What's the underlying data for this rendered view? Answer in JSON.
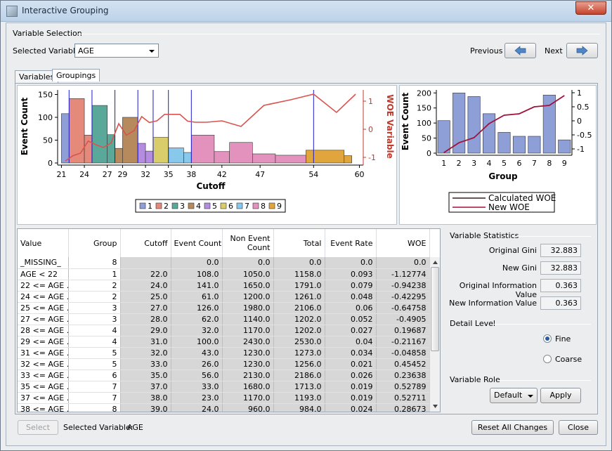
{
  "window": {
    "title": "Interactive Grouping",
    "close_glyph": "✕"
  },
  "variable_selection": {
    "section_title": "Variable Selection",
    "selected_label": "Selected Variable",
    "selected_value": "AGE",
    "previous_label": "Previous",
    "next_label": "Next"
  },
  "tabs": [
    {
      "label": "Variables"
    },
    {
      "label": "Groupings"
    }
  ],
  "chart_data": [
    {
      "type": "bar",
      "xlabel": "Cutoff",
      "ylabel": "Event Count",
      "y2label": "WOE Variable",
      "yticks": [
        0,
        50,
        100,
        150
      ],
      "y2ticks": [
        -1,
        0,
        1
      ],
      "xticks": [
        21,
        24,
        27,
        29,
        32,
        35,
        38,
        42,
        47,
        54,
        60
      ],
      "xlim": [
        20.5,
        60.5
      ],
      "ylim": [
        0,
        160
      ],
      "y2lim": [
        -1.2,
        1.4
      ],
      "groups": [
        {
          "name": "1",
          "color": "#8e9fd8"
        },
        {
          "name": "2",
          "color": "#e5897a"
        },
        {
          "name": "3",
          "color": "#5aa89a"
        },
        {
          "name": "4",
          "color": "#b68a5c"
        },
        {
          "name": "5",
          "color": "#b58de0"
        },
        {
          "name": "6",
          "color": "#d9cc6a"
        },
        {
          "name": "7",
          "color": "#88c8ea"
        },
        {
          "name": "8",
          "color": "#e391bd"
        },
        {
          "name": "9",
          "color": "#e0a53d"
        }
      ],
      "bars": [
        {
          "x0": 21,
          "x1": 22,
          "y": 108,
          "g": 0
        },
        {
          "x0": 22,
          "x1": 24,
          "y": 141,
          "g": 1
        },
        {
          "x0": 24,
          "x1": 25,
          "y": 61,
          "g": 1
        },
        {
          "x0": 25,
          "x1": 27,
          "y": 126,
          "g": 2
        },
        {
          "x0": 27,
          "x1": 28,
          "y": 62,
          "g": 2
        },
        {
          "x0": 28,
          "x1": 29,
          "y": 32,
          "g": 3
        },
        {
          "x0": 29,
          "x1": 31,
          "y": 100,
          "g": 3
        },
        {
          "x0": 31,
          "x1": 32,
          "y": 43,
          "g": 4
        },
        {
          "x0": 32,
          "x1": 33,
          "y": 26,
          "g": 4
        },
        {
          "x0": 33,
          "x1": 35,
          "y": 56,
          "g": 5
        },
        {
          "x0": 35,
          "x1": 37,
          "y": 33,
          "g": 6
        },
        {
          "x0": 37,
          "x1": 38,
          "y": 23,
          "g": 6
        },
        {
          "x0": 38,
          "x1": 41,
          "y": 61,
          "g": 7
        },
        {
          "x0": 41,
          "x1": 43,
          "y": 25,
          "g": 7
        },
        {
          "x0": 43,
          "x1": 46,
          "y": 45,
          "g": 7
        },
        {
          "x0": 46,
          "x1": 49,
          "y": 20,
          "g": 7
        },
        {
          "x0": 49,
          "x1": 53,
          "y": 17,
          "g": 7
        },
        {
          "x0": 53,
          "x1": 58,
          "y": 28,
          "g": 8
        },
        {
          "x0": 58,
          "x1": 59,
          "y": 16,
          "g": 8
        }
      ],
      "cutlines": [
        22,
        25,
        28,
        31,
        33,
        35,
        38,
        54
      ],
      "woe_x": [
        21.5,
        22.5,
        23.5,
        24.5,
        25.5,
        26.5,
        27.5,
        28.5,
        29.5,
        30.5,
        31.5,
        32.5,
        33.5,
        34.5,
        35.5,
        36.5,
        37.5,
        38.5,
        40,
        42,
        44.5,
        47.5,
        51,
        54,
        57,
        59.5
      ],
      "woe_y": [
        -1.13,
        -0.94,
        -0.85,
        -0.42,
        -0.55,
        -0.65,
        -0.49,
        0.2,
        -0.21,
        -0.05,
        0.45,
        0.24,
        0.3,
        0.53,
        0.53,
        0.53,
        0.29,
        0.25,
        0.25,
        0.3,
        0.1,
        0.85,
        1.05,
        1.25,
        0.6,
        1.25
      ]
    },
    {
      "type": "bar",
      "xlabel": "Group",
      "ylabel": "Event Count",
      "categories": [
        "1",
        "2",
        "3",
        "4",
        "5",
        "6",
        "7",
        "8",
        "9"
      ],
      "values": [
        108,
        200,
        188,
        131,
        69,
        56,
        56,
        193,
        44
      ],
      "yticks": [
        0,
        50,
        100,
        150,
        200
      ],
      "y2ticks": [
        -1.0,
        -0.5,
        0.0,
        0.5,
        1.0
      ],
      "ylim": [
        0,
        210
      ],
      "y2lim": [
        -1.15,
        1.1
      ],
      "legend": [
        "Calculated WOE",
        "New WOE"
      ],
      "woe": [
        -1.13,
        -0.78,
        -0.6,
        -0.1,
        0.2,
        0.25,
        0.5,
        0.55,
        0.9
      ]
    }
  ],
  "table": {
    "columns": [
      "Value",
      "Group",
      "Cutoff",
      "Event Count",
      "Non Event Count",
      "Total",
      "Event Rate",
      "WOE"
    ],
    "rows": [
      [
        "_MISSING_",
        "8",
        "",
        "0.0",
        "0.0",
        "0.0",
        "0.0",
        "0.0"
      ],
      [
        "AGE < 22",
        "1",
        "22.0",
        "108.0",
        "1050.0",
        "1158.0",
        "0.093",
        "-1.12774"
      ],
      [
        "22 <= AGE ...",
        "2",
        "24.0",
        "141.0",
        "1650.0",
        "1791.0",
        "0.079",
        "-0.94238"
      ],
      [
        "24 <= AGE ...",
        "2",
        "25.0",
        "61.0",
        "1200.0",
        "1261.0",
        "0.048",
        "-0.42295"
      ],
      [
        "25 <= AGE ...",
        "3",
        "27.0",
        "126.0",
        "1980.0",
        "2106.0",
        "0.06",
        "-0.64758"
      ],
      [
        "27 <= AGE ...",
        "3",
        "28.0",
        "62.0",
        "1140.0",
        "1202.0",
        "0.052",
        "-0.4905"
      ],
      [
        "28 <= AGE ...",
        "4",
        "29.0",
        "32.0",
        "1170.0",
        "1202.0",
        "0.027",
        "0.19687"
      ],
      [
        "29 <= AGE ...",
        "4",
        "31.0",
        "100.0",
        "2430.0",
        "2530.0",
        "0.04",
        "-0.21167"
      ],
      [
        "31 <= AGE ...",
        "5",
        "32.0",
        "43.0",
        "1230.0",
        "1273.0",
        "0.034",
        "-0.04858"
      ],
      [
        "32 <= AGE ...",
        "5",
        "33.0",
        "26.0",
        "1230.0",
        "1256.0",
        "0.021",
        "0.45452"
      ],
      [
        "33 <= AGE ...",
        "6",
        "35.0",
        "56.0",
        "2130.0",
        "2186.0",
        "0.026",
        "0.23638"
      ],
      [
        "35 <= AGE ...",
        "7",
        "37.0",
        "33.0",
        "1680.0",
        "1713.0",
        "0.019",
        "0.52789"
      ],
      [
        "37 <= AGE ...",
        "7",
        "38.0",
        "23.0",
        "1170.0",
        "1193.0",
        "0.019",
        "0.52711"
      ],
      [
        "38 <= AGE ...",
        "8",
        "39.0",
        "24.0",
        "960.0",
        "984.0",
        "0.024",
        "0.28673"
      ]
    ]
  },
  "stats": {
    "section_title": "Variable Statistics",
    "items": [
      {
        "label": "Original Gini",
        "value": "32.883"
      },
      {
        "label": "New Gini",
        "value": "32.883"
      },
      {
        "label": "Original Information Value",
        "value": "0.363"
      },
      {
        "label": "New Information Value",
        "value": "0.363"
      }
    ],
    "detail_title": "Detail Level",
    "fine_label": "Fine",
    "coarse_label": "Coarse",
    "detail_selected": "Fine",
    "role_title": "Variable Role",
    "role_value": "Default",
    "apply_label": "Apply"
  },
  "footer": {
    "select_label": "Select",
    "selected_variable_label": "Selected Variable:",
    "selected_variable_value": "AGE",
    "reset_label": "Reset All Changes",
    "close_label": "Close"
  }
}
